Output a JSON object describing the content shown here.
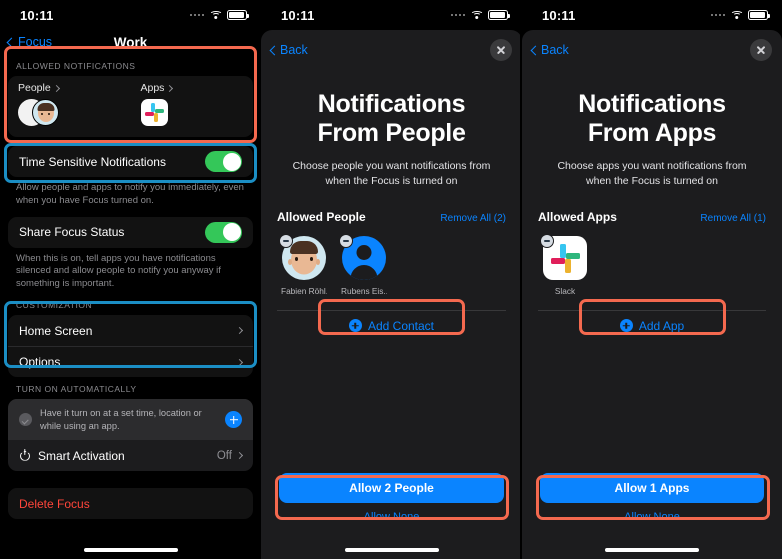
{
  "statusbar": {
    "time": "10:11"
  },
  "panel1": {
    "nav": {
      "back_label": "Focus",
      "title": "Work"
    },
    "allowed_notifications": {
      "section_label": "ALLOWED NOTIFICATIONS",
      "people_label": "People",
      "apps_label": "Apps"
    },
    "time_sensitive": {
      "label": "Time Sensitive Notifications",
      "toggle": "on",
      "footnote": "Allow people and apps to notify you immediately, even when you have Focus turned on."
    },
    "share_focus": {
      "label": "Share Focus Status",
      "toggle": "on",
      "footnote": "When this is on, tell apps you have notifications silenced and allow people to notify you anyway if something is important."
    },
    "customization": {
      "section_label": "CUSTOMIZATION",
      "rows": [
        {
          "label": "Home Screen"
        },
        {
          "label": "Options"
        }
      ]
    },
    "turn_on_automatically": {
      "section_label": "TURN ON AUTOMATICALLY",
      "hint": "Have it turn on at a set time, location or while using an app.",
      "smart_activation": {
        "label": "Smart Activation",
        "value": "Off"
      }
    },
    "delete_focus_label": "Delete Focus"
  },
  "panel2": {
    "nav": {
      "back_label": "Back"
    },
    "title": "Notifications From People",
    "title_line1": "Notifications",
    "title_line2": "From People",
    "subtitle": "Choose people you want notifications from when the Focus is turned on",
    "list_head": {
      "title": "Allowed People",
      "action": "Remove All (2)"
    },
    "people": [
      {
        "name": "Fabien Röhl..."
      },
      {
        "name": "Rubens Eis..."
      }
    ],
    "add_label": "Add Contact",
    "cta_label": "Allow 2 People",
    "cta_sub_label": "Allow None"
  },
  "panel3": {
    "nav": {
      "back_label": "Back"
    },
    "title": "Notifications From Apps",
    "title_line1": "Notifications",
    "title_line2": "From Apps",
    "subtitle": "Choose apps you want notifications from when the Focus is turned on",
    "list_head": {
      "title": "Allowed Apps",
      "action": "Remove All (1)"
    },
    "apps": [
      {
        "name": "Slack"
      }
    ],
    "add_label": "Add App",
    "cta_label": "Allow 1 Apps",
    "cta_sub_label": "Allow None"
  },
  "colors": {
    "accent_blue": "#0a84ff",
    "toggle_green": "#34c759",
    "danger_red": "#ff453a",
    "highlight_red": "#f4694f",
    "highlight_blue": "#1b8ec4",
    "sheet_bg": "#1c1c1e",
    "page_bg": "#000000"
  }
}
